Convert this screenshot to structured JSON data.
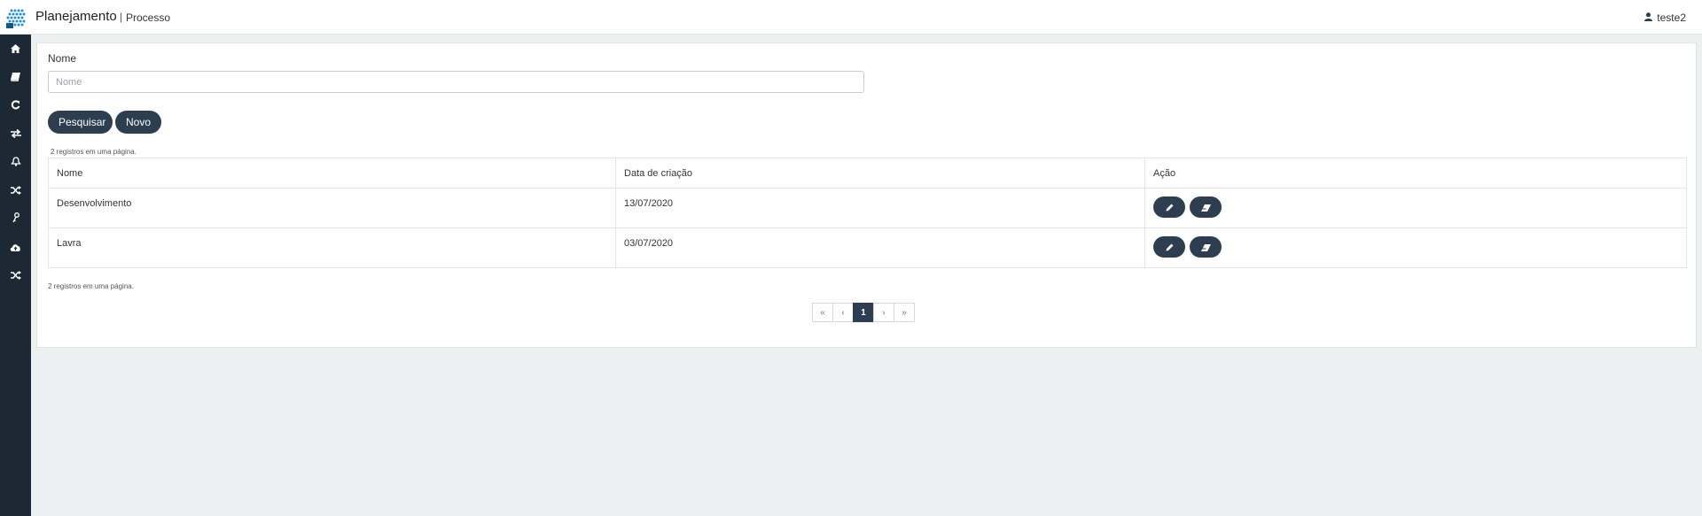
{
  "header": {
    "brand": "Planejamento",
    "separator": "|",
    "section": "Processo",
    "user": "teste2"
  },
  "sidebar": {
    "icons": [
      "home-icon",
      "book-icon",
      "refresh-icon",
      "exchange-icon",
      "bell-icon",
      "random-icon",
      "key-icon",
      "cloud-upload-icon",
      "random-icon"
    ]
  },
  "search": {
    "label": "Nome",
    "placeholder": "Nome",
    "value": ""
  },
  "buttons": {
    "search": "Pesquisar",
    "new": "Novo"
  },
  "records_info": "2 registros em uma página.",
  "table": {
    "headers": [
      "Nome",
      "Data de criação",
      "Ação"
    ],
    "rows": [
      {
        "nome": "Desenvolvimento",
        "data": "13/07/2020"
      },
      {
        "nome": "Lavra",
        "data": "03/07/2020"
      }
    ]
  },
  "pagination": {
    "first": "«",
    "prev": "‹",
    "current": "1",
    "next": "›",
    "last": "»"
  },
  "colors": {
    "accent": "#2c3e50",
    "sidebar": "#1c2833",
    "background": "#ecf0f1"
  }
}
